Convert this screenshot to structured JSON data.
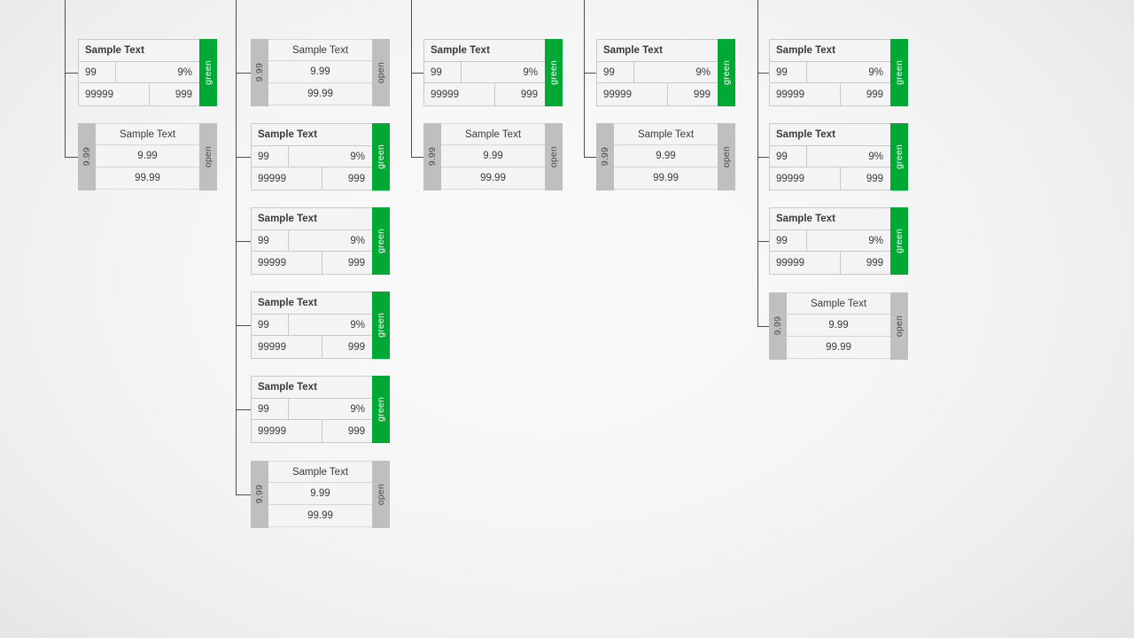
{
  "diagram": {
    "title_text": "Sample Text",
    "colors": {
      "green_accent": "#00a933",
      "gray_accent": "#bfbfbf",
      "connector": "#4d4d4d",
      "cell_bg": "#f4f4f4",
      "cell_border": "#c9c9c9"
    },
    "labels": {
      "green": "green",
      "open": "open"
    },
    "values": {
      "count": "99",
      "percent": "9%",
      "big": "99999",
      "small": "999",
      "decimal_small": "9.99",
      "decimal_large": "99.99"
    },
    "columns": [
      {
        "name": "column-1",
        "nodes": [
          {
            "type": "green",
            "title": "Sample Text",
            "side_label": "green",
            "cells": {
              "count": "99",
              "percent": "9%",
              "big": "99999",
              "small": "999"
            }
          },
          {
            "type": "open",
            "title": "Sample Text",
            "left_label": "9.99",
            "right_label": "open",
            "cells": {
              "decimal_small": "9.99",
              "decimal_large": "99.99"
            }
          }
        ]
      },
      {
        "name": "column-2",
        "nodes": [
          {
            "type": "open",
            "title": "Sample Text",
            "left_label": "9.99",
            "right_label": "open",
            "cells": {
              "decimal_small": "9.99",
              "decimal_large": "99.99"
            }
          },
          {
            "type": "green",
            "title": "Sample Text",
            "side_label": "green",
            "cells": {
              "count": "99",
              "percent": "9%",
              "big": "99999",
              "small": "999"
            }
          },
          {
            "type": "green",
            "title": "Sample Text",
            "side_label": "green",
            "cells": {
              "count": "99",
              "percent": "9%",
              "big": "99999",
              "small": "999"
            }
          },
          {
            "type": "green",
            "title": "Sample Text",
            "side_label": "green",
            "cells": {
              "count": "99",
              "percent": "9%",
              "big": "99999",
              "small": "999"
            }
          },
          {
            "type": "green",
            "title": "Sample Text",
            "side_label": "green",
            "cells": {
              "count": "99",
              "percent": "9%",
              "big": "99999",
              "small": "999"
            }
          },
          {
            "type": "open",
            "title": "Sample Text",
            "left_label": "9.99",
            "right_label": "open",
            "cells": {
              "decimal_small": "9.99",
              "decimal_large": "99.99"
            }
          }
        ]
      },
      {
        "name": "column-3",
        "nodes": [
          {
            "type": "green",
            "title": "Sample Text",
            "side_label": "green",
            "cells": {
              "count": "99",
              "percent": "9%",
              "big": "99999",
              "small": "999"
            }
          },
          {
            "type": "open",
            "title": "Sample Text",
            "left_label": "9.99",
            "right_label": "open",
            "cells": {
              "decimal_small": "9.99",
              "decimal_large": "99.99"
            }
          }
        ]
      },
      {
        "name": "column-4",
        "nodes": [
          {
            "type": "green",
            "title": "Sample Text",
            "side_label": "green",
            "cells": {
              "count": "99",
              "percent": "9%",
              "big": "99999",
              "small": "999"
            }
          },
          {
            "type": "open",
            "title": "Sample Text",
            "left_label": "9.99",
            "right_label": "open",
            "cells": {
              "decimal_small": "9.99",
              "decimal_large": "99.99"
            }
          }
        ]
      },
      {
        "name": "column-5",
        "nodes": [
          {
            "type": "green",
            "title": "Sample Text",
            "side_label": "green",
            "cells": {
              "count": "99",
              "percent": "9%",
              "big": "99999",
              "small": "999"
            }
          },
          {
            "type": "green",
            "title": "Sample Text",
            "side_label": "green",
            "cells": {
              "count": "99",
              "percent": "9%",
              "big": "99999",
              "small": "999"
            }
          },
          {
            "type": "green",
            "title": "Sample Text",
            "side_label": "green",
            "cells": {
              "count": "99",
              "percent": "9%",
              "big": "99999",
              "small": "999"
            }
          },
          {
            "type": "open",
            "title": "Sample Text",
            "left_label": "9.99",
            "right_label": "open",
            "cells": {
              "decimal_small": "9.99",
              "decimal_large": "99.99"
            }
          }
        ]
      }
    ]
  }
}
